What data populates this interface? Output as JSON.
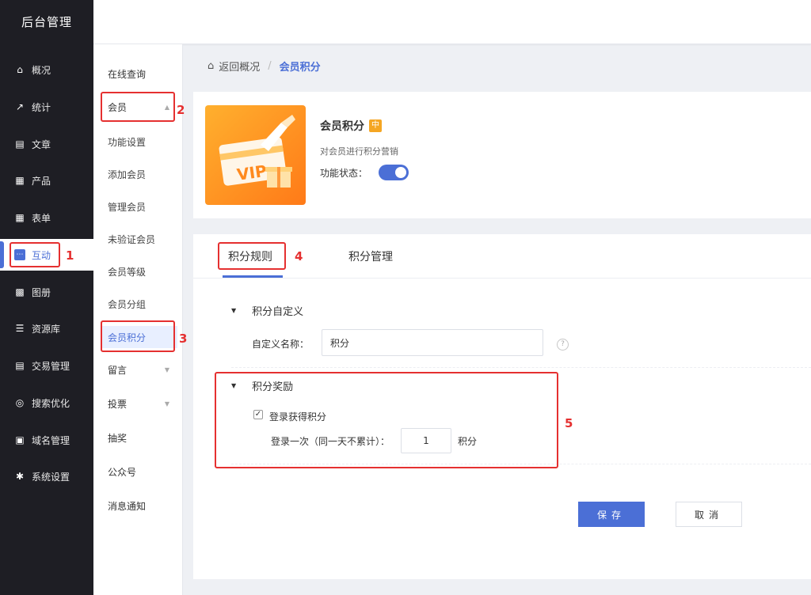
{
  "sidebar": {
    "brand": "后台管理",
    "items": [
      {
        "label": "概况",
        "icon": "home-icon"
      },
      {
        "label": "统计",
        "icon": "chart-icon"
      },
      {
        "label": "文章",
        "icon": "article-icon"
      },
      {
        "label": "产品",
        "icon": "product-icon"
      },
      {
        "label": "表单",
        "icon": "form-icon"
      },
      {
        "label": "互动",
        "icon": "chat-icon"
      },
      {
        "label": "图册",
        "icon": "album-icon"
      },
      {
        "label": "资源库",
        "icon": "database-icon"
      },
      {
        "label": "交易管理",
        "icon": "trade-icon"
      },
      {
        "label": "搜索优化",
        "icon": "seo-icon"
      },
      {
        "label": "域名管理",
        "icon": "domain-icon"
      },
      {
        "label": "系统设置",
        "icon": "gear-icon"
      }
    ]
  },
  "subnav": {
    "items": [
      "在线查询",
      "会员",
      "功能设置",
      "添加会员",
      "管理会员",
      "未验证会员",
      "会员等级",
      "会员分组",
      "会员积分",
      "留言",
      "投票",
      "抽奖",
      "公众号",
      "消息通知"
    ]
  },
  "breadcrumb": {
    "back": "返回概况",
    "separator": "/",
    "current": "会员积分"
  },
  "app": {
    "title": "会员积分",
    "badge": "中",
    "description": "对会员进行积分营销",
    "status_label": "功能状态："
  },
  "tabs": [
    "积分规则",
    "积分管理"
  ],
  "sections": {
    "custom": {
      "title": "积分自定义",
      "name_label": "自定义名称：",
      "name_value": "积分"
    },
    "reward": {
      "title": "积分奖励",
      "login_check_label": "登录获得积分",
      "login_once_label": "登录一次（同一天不累计）：",
      "login_value": "1",
      "unit": "积分"
    }
  },
  "buttons": {
    "save": "保存",
    "cancel": "取消"
  },
  "annotations": [
    "1",
    "2",
    "3",
    "4",
    "5"
  ],
  "colors": {
    "accent": "#4b6fd6",
    "sidebar_bg": "#1e1e24",
    "annotation": "#e53030",
    "badge": "#f5a623"
  }
}
